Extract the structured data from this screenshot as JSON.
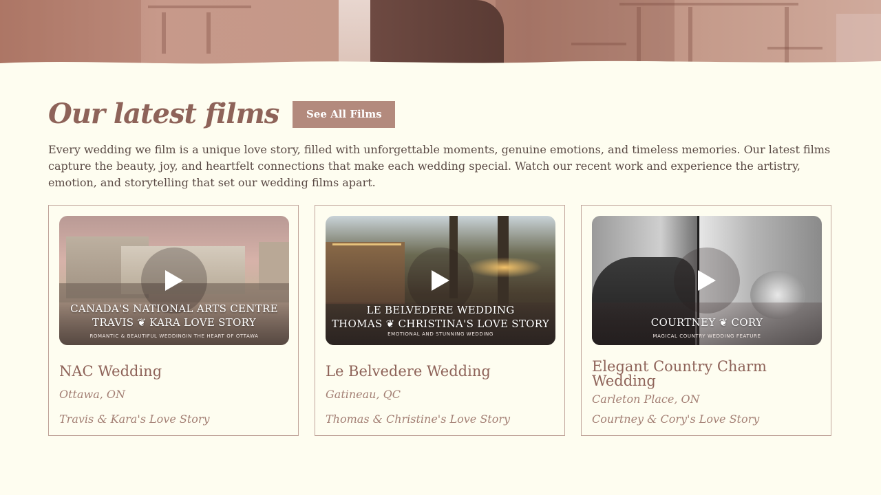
{
  "section": {
    "title": "Our latest films",
    "see_all_label": "See All Films",
    "intro": "Every wedding we film is a unique love story, filled with unforgettable moments, genuine emotions, and timeless memories. Our latest films capture the beauty, joy, and heartfelt connections that make each wedding special. Watch our recent work and experience the artistry, emotion, and storytelling that set our wedding films apart."
  },
  "films": [
    {
      "title": "NAC Wedding",
      "location": "Ottawa, ON",
      "story": "Travis & Kara's Love Story",
      "thumb_line1": "CANADA'S NATIONAL ARTS CENTRE",
      "thumb_line2": "TRAVIS ❦ KARA LOVE STORY",
      "thumb_line3": "ROMANTIC & BEAUTIFUL WEDDINGIN THE HEART OF OTTAWA"
    },
    {
      "title": "Le Belvedere Wedding",
      "location": "Gatineau, QC",
      "story": "Thomas & Christine's Love Story",
      "thumb_line1": "LE BELVEDERE WEDDING",
      "thumb_line2": "THOMAS ❦ CHRISTINA'S LOVE STORY",
      "thumb_line3": "EMOTIONAL AND STUNNING WEDDING"
    },
    {
      "title": "Elegant Country Charm Wedding",
      "location": "Carleton Place, ON",
      "story": "Courtney & Cory's Love Story",
      "thumb_line1": "",
      "thumb_line2": "COURTNEY ❦ CORY",
      "thumb_line3": "MAGICAL COUNTRY WEDDING FEATURE"
    }
  ],
  "icons": {
    "play": "play-icon"
  },
  "colors": {
    "background": "#fefdf0",
    "accent": "#b38a7d",
    "heading": "#8e6359",
    "muted": "#a37f74"
  }
}
